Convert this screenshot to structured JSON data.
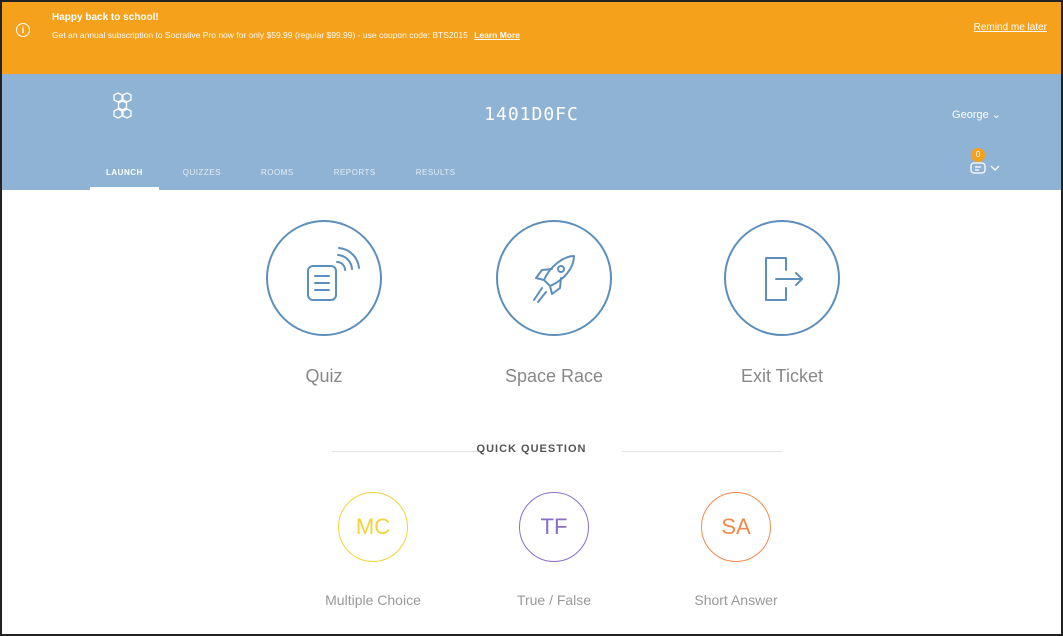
{
  "banner": {
    "title": "Happy back to school!",
    "message": "Get an annual subscription to Socrative Pro now for only $59.99 (regular $99.99) - use coupon code: BTS2015",
    "learn_more": "Learn More",
    "remind": "Remind me later",
    "info_icon": "info-icon"
  },
  "header": {
    "room_name": "1401D0FC",
    "user": "George ⌄",
    "notification_count": "0",
    "tabs": [
      {
        "label": "LAUNCH"
      },
      {
        "label": "QUIZZES"
      },
      {
        "label": "ROOMS"
      },
      {
        "label": "REPORTS"
      },
      {
        "label": "RESULTS"
      }
    ]
  },
  "activities": [
    {
      "label": "Quiz",
      "icon": "quiz-broadcast-icon"
    },
    {
      "label": "Space Race",
      "icon": "rocket-icon"
    },
    {
      "label": "Exit Ticket",
      "icon": "exit-door-icon"
    }
  ],
  "quick_question": {
    "title": "QUICK QUESTION",
    "items": [
      {
        "abbr": "MC",
        "label": "Multiple Choice",
        "color": "#f0d33a"
      },
      {
        "abbr": "TF",
        "label": "True / False",
        "color": "#8a6fc9"
      },
      {
        "abbr": "SA",
        "label": "Short Answer",
        "color": "#f08a4b"
      }
    ]
  },
  "colors": {
    "banner": "#f5a11c",
    "header": "#8fb3d5",
    "activity_outline": "#5c8fbc"
  }
}
